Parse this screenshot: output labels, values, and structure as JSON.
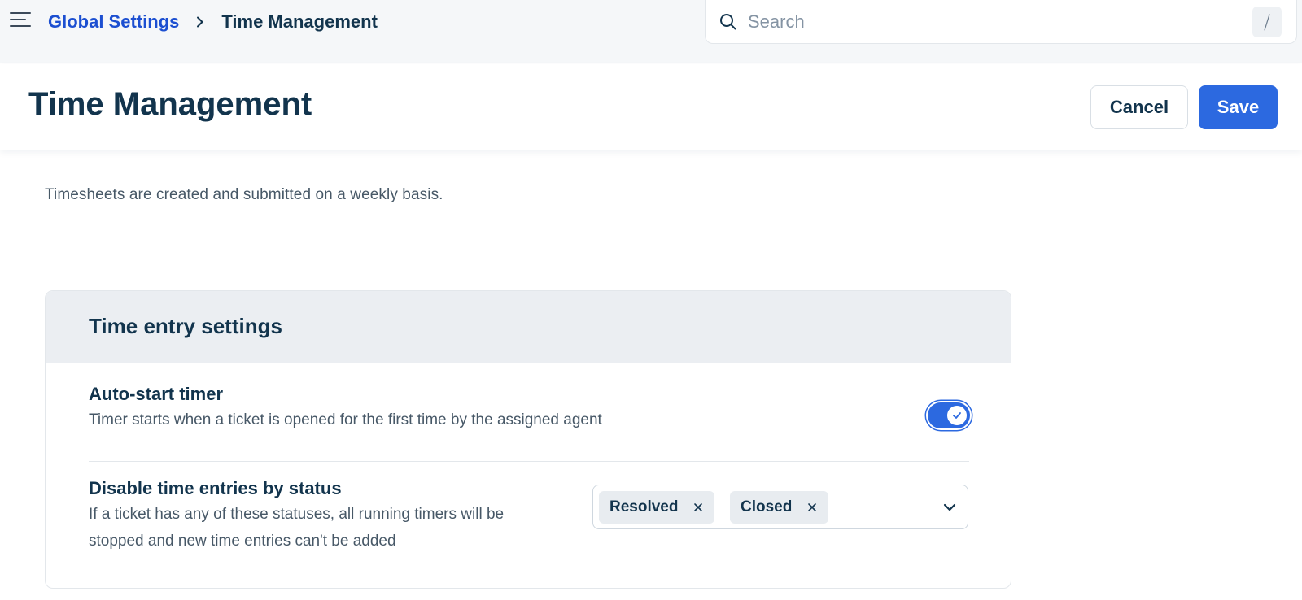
{
  "topbar": {
    "breadcrumb_parent": "Global Settings",
    "breadcrumb_current": "Time Management",
    "search_placeholder": "Search",
    "search_shortcut": "/"
  },
  "header": {
    "title": "Time Management",
    "cancel_label": "Cancel",
    "save_label": "Save"
  },
  "intro_text": "Timesheets are created and submitted on a weekly basis.",
  "card": {
    "title": "Time entry settings",
    "auto_start": {
      "title": "Auto-start timer",
      "description": "Timer starts when a ticket is opened for the first time by the assigned agent",
      "enabled": true
    },
    "disable_by_status": {
      "title": "Disable time entries by status",
      "description_line1": "If a ticket has any of these statuses, all running timers will be",
      "description_line2": "stopped and new time entries can't be added",
      "selected": [
        "Resolved",
        "Closed"
      ]
    }
  },
  "colors": {
    "accent": "#2c69e0",
    "link": "#1c4fd1",
    "text_primary": "#12344d",
    "text_secondary": "#475867"
  },
  "icons": {
    "menu": "hamburger-icon",
    "breadcrumb_separator": "chevron-right-icon",
    "search": "search-icon",
    "toggle_on": "check-icon",
    "chip_remove": "close-icon",
    "dropdown": "chevron-down-icon"
  }
}
